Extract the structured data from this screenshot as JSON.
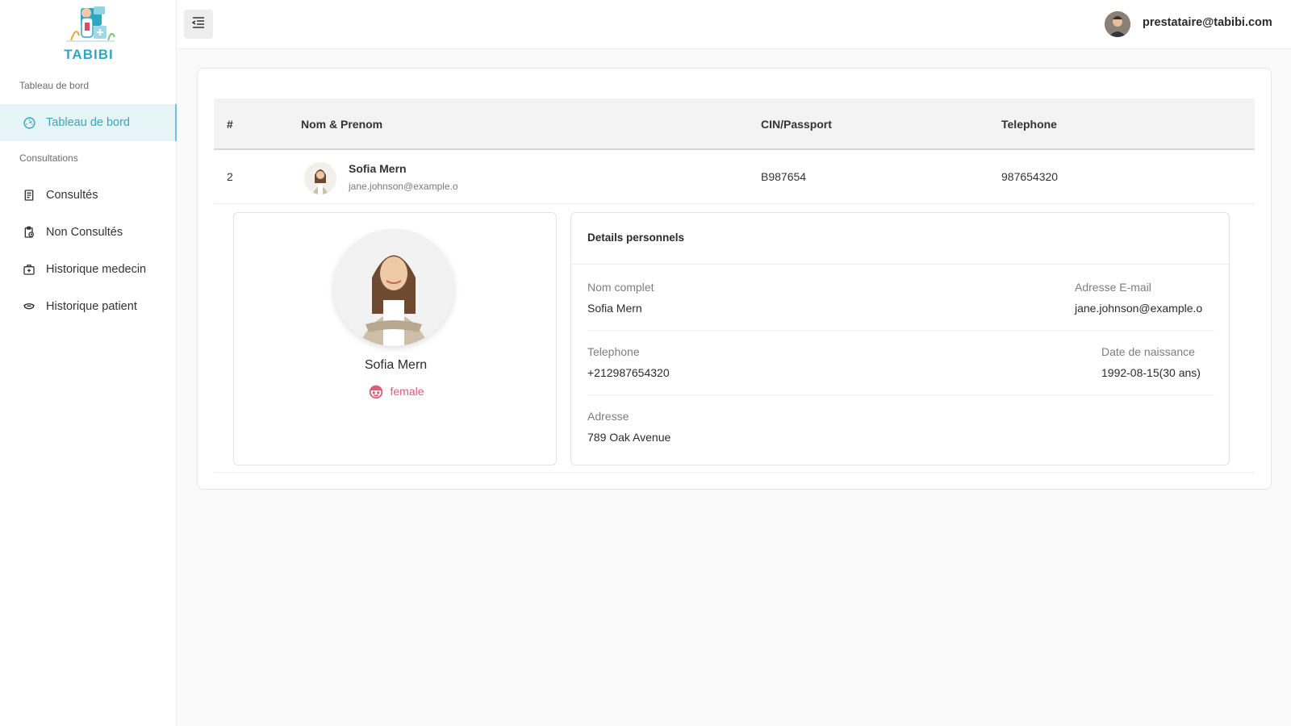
{
  "brand": {
    "name": "TABIBI"
  },
  "sidebar": {
    "section_dashboard": "Tableau de bord",
    "section_consultations": "Consultations",
    "items": [
      {
        "label": "Tableau de bord",
        "icon": "dashboard-icon",
        "active": true
      },
      {
        "label": "Consultés",
        "icon": "receipt-icon"
      },
      {
        "label": "Non Consultés",
        "icon": "clipboard-clock-icon"
      },
      {
        "label": "Historique medecin",
        "icon": "medical-bag-icon"
      },
      {
        "label": "Historique patient",
        "icon": "patient-mask-icon"
      }
    ]
  },
  "header": {
    "menu_icon": "menu-collapse-icon",
    "user_email": "prestataire@tabibi.com"
  },
  "table": {
    "columns": [
      "#",
      "Nom & Prenom",
      "CIN/Passport",
      "Telephone"
    ],
    "rows": [
      {
        "index": "2",
        "name": "Sofia Mern",
        "email": "jane.johnson@example.o",
        "cin": "B987654",
        "phone": "987654320"
      }
    ]
  },
  "profile": {
    "name": "Sofia Mern",
    "gender": "female",
    "gender_color": "#e05a7a"
  },
  "details": {
    "title": "Details personnels",
    "full_name_label": "Nom complet",
    "full_name": "Sofia Mern",
    "email_label": "Adresse E-mail",
    "email": "jane.johnson@example.o",
    "phone_label": "Telephone",
    "phone": "+212987654320",
    "birth_label": "Date de naissance",
    "birth": "1992-08-15(30 ans)",
    "address_label": "Adresse",
    "address": "789 Oak Avenue"
  },
  "colors": {
    "accent": "#3aa5ba",
    "active_bg": "#e4f4f7"
  }
}
